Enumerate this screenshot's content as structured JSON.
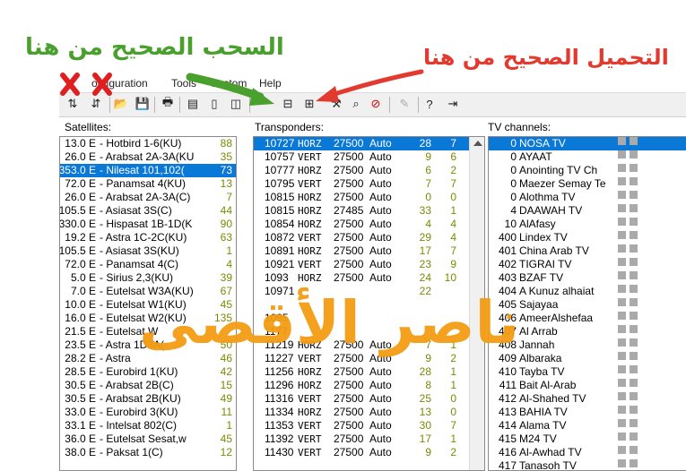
{
  "menu": [
    "Configuration",
    "Tools",
    "Custom",
    "Help"
  ],
  "menu_partial": [
    "onfiguration",
    "Tools",
    "Custom",
    "Help"
  ],
  "annotations": {
    "left_text": "السحب الصحيح من هنا",
    "right_text": "التحميل الصحيح من هنا",
    "watermark": "ناصر الأقصى",
    "green": "#4aa02c",
    "red": "#e23a2e",
    "orange": "#f39c12"
  },
  "labels": {
    "satellites": "Satellites:",
    "transponders": "Transponders:",
    "channels": "TV channels:"
  },
  "satellites": [
    {
      "pos": "13.0 E",
      "name": "- Hotbird 1-6(KU)",
      "count": "88"
    },
    {
      "pos": "26.0 E",
      "name": "- Arabsat 2A-3A(KU",
      "count": "35"
    },
    {
      "pos": "353.0 E",
      "name": "- Nilesat 101,102(",
      "count": "73",
      "selected": true
    },
    {
      "pos": "72.0 E",
      "name": "- Panamsat 4(KU)",
      "count": "13"
    },
    {
      "pos": "26.0 E",
      "name": "- Arabsat 2A-3A(C)",
      "count": "7"
    },
    {
      "pos": "105.5 E",
      "name": "- Asiasat 3S(C)",
      "count": "44"
    },
    {
      "pos": "330.0 E",
      "name": "- Hispasat 1B-1D(K",
      "count": "90"
    },
    {
      "pos": "19.2 E",
      "name": "- Astra 1C-2C(KU)",
      "count": "63"
    },
    {
      "pos": "105.5 E",
      "name": "- Asiasat 3S(KU)",
      "count": "1"
    },
    {
      "pos": "72.0 E",
      "name": "- Panamsat 4(C)",
      "count": "4"
    },
    {
      "pos": "5.0 E",
      "name": "- Sirius 2,3(KU)",
      "count": "39"
    },
    {
      "pos": "7.0 E",
      "name": "- Eutelsat W3A(KU)",
      "count": "67"
    },
    {
      "pos": "10.0 E",
      "name": "- Eutelsat W1(KU)",
      "count": "45"
    },
    {
      "pos": "16.0 E",
      "name": "- Eutelsat W2(KU)",
      "count": "135"
    },
    {
      "pos": "21.5 E",
      "name": "- Eutelsat W",
      "count": ""
    },
    {
      "pos": "23.5 E",
      "name": "- Astra 1D3A(",
      "count": "50"
    },
    {
      "pos": "28.2 E",
      "name": "- Astra",
      "count": "46"
    },
    {
      "pos": "28.5 E",
      "name": "- Eurobird 1(KU)",
      "count": "42"
    },
    {
      "pos": "30.5 E",
      "name": "- Arabsat 2B(C)",
      "count": "15"
    },
    {
      "pos": "30.5 E",
      "name": "- Arabsat 2B(KU)",
      "count": "49"
    },
    {
      "pos": "33.0 E",
      "name": "- Eurobird 3(KU)",
      "count": "11"
    },
    {
      "pos": "33.1 E",
      "name": "- Intelsat 802(C)",
      "count": "1"
    },
    {
      "pos": "36.0 E",
      "name": "- Eutelsat Sesat,w",
      "count": "45"
    },
    {
      "pos": "38.0 E",
      "name": "- Paksat 1(C)",
      "count": "12"
    }
  ],
  "transponders": [
    {
      "freq": "10727",
      "pol": "HORZ",
      "sr": "27500",
      "fec": "Auto",
      "a": "28",
      "b": "7",
      "selected": true
    },
    {
      "freq": "10757",
      "pol": "VERT",
      "sr": "27500",
      "fec": "Auto",
      "a": "9",
      "b": "6"
    },
    {
      "freq": "10777",
      "pol": "HORZ",
      "sr": "27500",
      "fec": "Auto",
      "a": "6",
      "b": "2"
    },
    {
      "freq": "10795",
      "pol": "VERT",
      "sr": "27500",
      "fec": "Auto",
      "a": "7",
      "b": "7"
    },
    {
      "freq": "10815",
      "pol": "HORZ",
      "sr": "27500",
      "fec": "Auto",
      "a": "0",
      "b": "0"
    },
    {
      "freq": "10815",
      "pol": "HORZ",
      "sr": "27485",
      "fec": "Auto",
      "a": "33",
      "b": "1"
    },
    {
      "freq": "10854",
      "pol": "HORZ",
      "sr": "27500",
      "fec": "Auto",
      "a": "4",
      "b": "4"
    },
    {
      "freq": "10872",
      "pol": "VERT",
      "sr": "27500",
      "fec": "Auto",
      "a": "29",
      "b": "4"
    },
    {
      "freq": "10891",
      "pol": "HORZ",
      "sr": "27500",
      "fec": "Auto",
      "a": "17",
      "b": "7"
    },
    {
      "freq": "10921",
      "pol": "VERT",
      "sr": "27500",
      "fec": "Auto",
      "a": "23",
      "b": "9"
    },
    {
      "freq": "1093",
      "pol": "HORZ",
      "sr": "27500",
      "fec": "Auto",
      "a": "24",
      "b": "10"
    },
    {
      "freq": "10971",
      "pol": "",
      "sr": "",
      "fec": "",
      "a": "22",
      "b": ""
    },
    {
      "freq": "",
      "pol": "",
      "sr": "",
      "fec": "",
      "a": "",
      "b": ""
    },
    {
      "freq": "1095",
      "pol": "",
      "sr": "",
      "fec": "",
      "a": "",
      "b": ""
    },
    {
      "freq": "1177",
      "pol": "",
      "sr": "",
      "fec": "",
      "a": "",
      "b": ""
    },
    {
      "freq": "11219",
      "pol": "HORZ",
      "sr": "27500",
      "fec": "Auto",
      "a": "7",
      "b": "1"
    },
    {
      "freq": "11227",
      "pol": "VERT",
      "sr": "27500",
      "fec": "Auto",
      "a": "9",
      "b": "2"
    },
    {
      "freq": "11256",
      "pol": "HORZ",
      "sr": "27500",
      "fec": "Auto",
      "a": "28",
      "b": "1"
    },
    {
      "freq": "11296",
      "pol": "HORZ",
      "sr": "27500",
      "fec": "Auto",
      "a": "8",
      "b": "1"
    },
    {
      "freq": "11316",
      "pol": "VERT",
      "sr": "27500",
      "fec": "Auto",
      "a": "25",
      "b": "0"
    },
    {
      "freq": "11334",
      "pol": "HORZ",
      "sr": "27500",
      "fec": "Auto",
      "a": "13",
      "b": "0"
    },
    {
      "freq": "11353",
      "pol": "VERT",
      "sr": "27500",
      "fec": "Auto",
      "a": "30",
      "b": "7"
    },
    {
      "freq": "11392",
      "pol": "VERT",
      "sr": "27500",
      "fec": "Auto",
      "a": "17",
      "b": "1"
    },
    {
      "freq": "11430",
      "pol": "VERT",
      "sr": "27500",
      "fec": "Auto",
      "a": "9",
      "b": "2"
    }
  ],
  "channels": [
    {
      "num": "0",
      "name": "NOSA TV",
      "selected": true
    },
    {
      "num": "0",
      "name": "AYAAT"
    },
    {
      "num": "0",
      "name": "Anointing TV Ch"
    },
    {
      "num": "0",
      "name": "Maezer Semay Te"
    },
    {
      "num": "0",
      "name": "Alothma TV"
    },
    {
      "num": "4",
      "name": "DAAWAH TV"
    },
    {
      "num": "10",
      "name": "AlAfasy"
    },
    {
      "num": "400",
      "name": "Lindex TV"
    },
    {
      "num": "401",
      "name": "China Arab TV"
    },
    {
      "num": "402",
      "name": "TIGRAI  TV"
    },
    {
      "num": "403",
      "name": "BZAF TV"
    },
    {
      "num": "404",
      "name": "A Kunuz alhaiat"
    },
    {
      "num": "405",
      "name": "Sajayaa"
    },
    {
      "num": "406",
      "name": "AmeerAlshefaa"
    },
    {
      "num": "407",
      "name": "Al Arrab"
    },
    {
      "num": "408",
      "name": "Jannah"
    },
    {
      "num": "409",
      "name": "Albaraka"
    },
    {
      "num": "410",
      "name": "Tayba TV"
    },
    {
      "num": "411",
      "name": "Bait Al-Arab"
    },
    {
      "num": "412",
      "name": "Al-Shahed TV"
    },
    {
      "num": "413",
      "name": "BAHIA TV"
    },
    {
      "num": "414",
      "name": "Alama TV"
    },
    {
      "num": "415",
      "name": "M24 TV"
    },
    {
      "num": "416",
      "name": "Al-Awhad TV"
    },
    {
      "num": "417",
      "name": "Tanasoh TV"
    }
  ]
}
